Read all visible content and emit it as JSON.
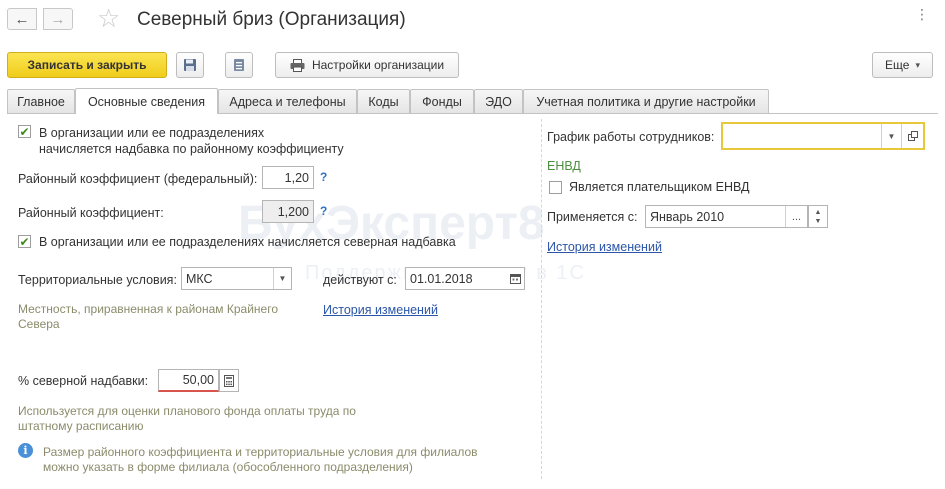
{
  "window": {
    "title": "Северный бриз (Организация)",
    "nav_back_icon": "←",
    "nav_forward_icon": "→",
    "favorite_icon": "☆",
    "menu_icon": "⋮",
    "maximize_icon": "□",
    "close_icon": "✕"
  },
  "toolbar": {
    "save_close_label": "Записать и закрыть",
    "save_icon": "floppy-disk",
    "report_icon": "document-list",
    "settings_icon": "printer",
    "settings_label": "Настройки организации",
    "more_label": "Еще",
    "more_arrow": "▾"
  },
  "tabs": [
    {
      "label": "Главное"
    },
    {
      "label": "Основные сведения"
    },
    {
      "label": "Адреса и телефоны"
    },
    {
      "label": "Коды"
    },
    {
      "label": "Фонды"
    },
    {
      "label": "ЭДО"
    },
    {
      "label": "Учетная политика и другие настройки"
    }
  ],
  "left": {
    "regional_checkbox_label_1": "В организации или ее подразделениях",
    "regional_checkbox_label_2": "начисляется надбавка по районному коэффициенту",
    "regional_checked": true,
    "coef_federal_label": "Районный коэффициент (федеральный):",
    "coef_federal_value": "1,20",
    "coef_label": "Районный коэффициент:",
    "coef_value": "1,200",
    "help_mark": "?",
    "north_checkbox_label": "В организации или ее подразделениях начисляется северная надбавка",
    "north_checked": true,
    "terr_label": "Территориальные условия:",
    "terr_value": "МКС",
    "acting_label": "действуют с:",
    "acting_value": "01.01.2018",
    "terr_note_1": "Местность, приравненная к районам Крайнего",
    "terr_note_2": "Севера",
    "history_link": "История изменений",
    "north_pct_label": "% северной надбавки:",
    "north_pct_value": "50,00",
    "plan_note_1": "Используется для оценки планового фонда оплаты труда по",
    "plan_note_2": "штатному расписанию",
    "info_note_1": "Размер районного коэффициента и территориальные условия для филиалов",
    "info_note_2": "можно указать в форме филиала (обособленного подразделения)"
  },
  "right": {
    "schedule_label": "График работы сотрудников:",
    "schedule_value": "",
    "envd_header": "ЕНВД",
    "envd_checkbox_label": "Является плательщиком ЕНВД",
    "envd_checked": false,
    "applied_label": "Применяется с:",
    "applied_value": "Январь 2010",
    "history_link": "История изменений"
  },
  "watermark": {
    "brand": "БухЭксперт8",
    "tagline": "Поддержка по учету в 1С"
  },
  "colors": {
    "primary_button": "#f5d52e",
    "link": "#2b55a8",
    "envd_green": "#4a8f3e",
    "check_green": "#3f8a1f",
    "focus_border": "#e8c83a",
    "error_underline": "#d9534f",
    "info_icon": "#4a90d9"
  }
}
